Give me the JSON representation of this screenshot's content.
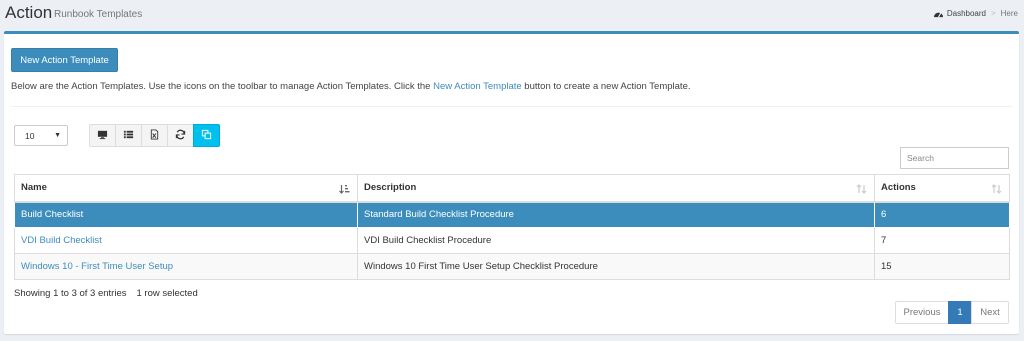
{
  "header": {
    "title": "Action",
    "subtitle": "Runbook Templates",
    "breadcrumb": [
      {
        "label": "Dashboard",
        "icon": "dashboard-icon"
      },
      {
        "label": "Here"
      }
    ]
  },
  "toolbar_top": {
    "new_button_label": "New Action Template"
  },
  "description": {
    "prefix": "Below are the Action Templates. Use the icons on the toolbar to manage Action Templates. Click the ",
    "link": "New Action Template",
    "suffix": " button to create a new Action Template."
  },
  "page_size": {
    "value": "10"
  },
  "toolbar_icons": [
    {
      "name": "monitor-icon",
      "active": false
    },
    {
      "name": "list-icon",
      "active": false
    },
    {
      "name": "excel-export-icon",
      "active": false
    },
    {
      "name": "refresh-icon",
      "active": false
    },
    {
      "name": "copy-icon",
      "active": true
    }
  ],
  "search": {
    "placeholder": "Search",
    "value": ""
  },
  "table": {
    "columns": [
      "Name",
      "Description",
      "Actions"
    ],
    "rows": [
      {
        "name": "Build Checklist",
        "description": "Standard Build Checklist Procedure",
        "actions": "6",
        "selected": true
      },
      {
        "name": "VDI Build Checklist",
        "description": "VDI Build Checklist Procedure",
        "actions": "7",
        "selected": false
      },
      {
        "name": "Windows 10 - First Time User Setup",
        "description": "Windows 10 First Time User Setup Checklist Procedure",
        "actions": "15",
        "selected": false
      }
    ]
  },
  "info": {
    "entries": "Showing 1 to 3 of 3 entries",
    "selected": "1 row selected"
  },
  "pagination": {
    "previous": "Previous",
    "current": "1",
    "next": "Next"
  },
  "colors": {
    "primary": "#3c8dbc",
    "info": "#00c0ef",
    "background": "#ecf0f5"
  }
}
